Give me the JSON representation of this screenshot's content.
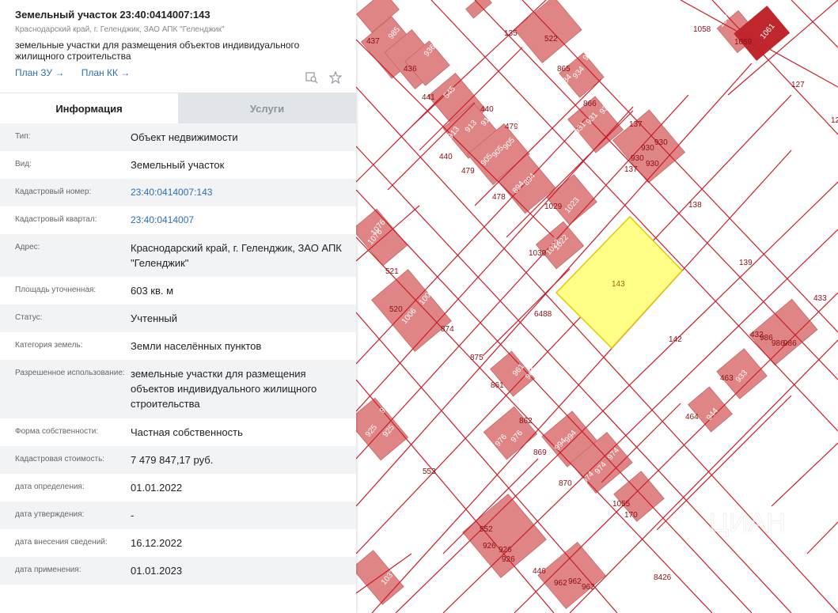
{
  "header": {
    "title": "Земельный участок 23:40:0414007:143",
    "address": "Краснодарский край, г. Геленджик, ЗАО АПК \"Геленджик\"",
    "purpose": "земельные участки для размещения объектов индивидуального жилищного строительства",
    "link_plan_zu": "План ЗУ →",
    "link_plan_kk": "План КК →",
    "icons": [
      "map-search-icon",
      "star-icon"
    ]
  },
  "tabs": [
    {
      "label": "Информация",
      "active": true
    },
    {
      "label": "Услуги",
      "active": false
    }
  ],
  "rows": [
    {
      "label": "Тип:",
      "value": "Объект недвижимости"
    },
    {
      "label": "Вид:",
      "value": "Земельный участок"
    },
    {
      "label": "Кадастровый номер:",
      "value": "23:40:0414007:143",
      "link": true
    },
    {
      "label": "Кадастровый квартал:",
      "value": "23:40:0414007",
      "link": true
    },
    {
      "label": "Адрес:",
      "value": "Краснодарский край, г. Геленджик, ЗАО АПК \"Геленджик\""
    },
    {
      "label": "Площадь уточненная:",
      "value": "603 кв. м"
    },
    {
      "label": "Статус:",
      "value": "Учтенный"
    },
    {
      "label": "Категория земель:",
      "value": "Земли населённых пунктов"
    },
    {
      "label": "Разрешенное использование:",
      "value": "земельные участки для размещения объектов индивидуального жилищного строительства"
    },
    {
      "label": "Форма собственности:",
      "value": "Частная собственность"
    },
    {
      "label": "Кадастровая стоимость:",
      "value": "7 479 847,17 руб."
    },
    {
      "label": "дата определения:",
      "value": "01.01.2022"
    },
    {
      "label": "дата утверждения:",
      "value": "-"
    },
    {
      "label": "дата внесения сведений:",
      "value": "16.12.2022"
    },
    {
      "label": "дата применения:",
      "value": "01.01.2023"
    }
  ],
  "map": {
    "selected_parcel": "143",
    "parcel_labels": [
      "437",
      "985",
      "936",
      "436",
      "441",
      "545",
      "135",
      "522",
      "865",
      "934",
      "934",
      "934",
      "866",
      "931",
      "931",
      "931",
      "440",
      "913",
      "913",
      "913",
      "440",
      "479",
      "1083",
      "479",
      "905",
      "905",
      "905",
      "930",
      "930",
      "930",
      "930",
      "137",
      "137",
      "1058",
      "1077",
      "1078",
      "1059",
      "1061",
      "127",
      "478",
      "894",
      "894",
      "1029",
      "1023",
      "138",
      "1030",
      "1022",
      "1022",
      "139",
      "1076",
      "1076",
      "521",
      "520",
      "1006",
      "1006",
      "874",
      "6488",
      "142",
      "433",
      "432",
      "986",
      "986",
      "986",
      "875",
      "861",
      "961",
      "961",
      "463",
      "933",
      "464",
      "944",
      "925",
      "925",
      "925",
      "862",
      "976",
      "976",
      "869",
      "994",
      "994",
      "870",
      "974",
      "974",
      "974",
      "553",
      "1055",
      "170",
      "552",
      "926",
      "926",
      "926",
      "446",
      "962",
      "962",
      "962",
      "8426",
      "1037",
      "12"
    ],
    "colors": {
      "building": "#e08585",
      "building_dark": "#c0272d",
      "selected_fill": "#ffff88",
      "selected_stroke": "#e6c800",
      "boundary": "#c81e2b",
      "label": "#8b0d12"
    }
  }
}
